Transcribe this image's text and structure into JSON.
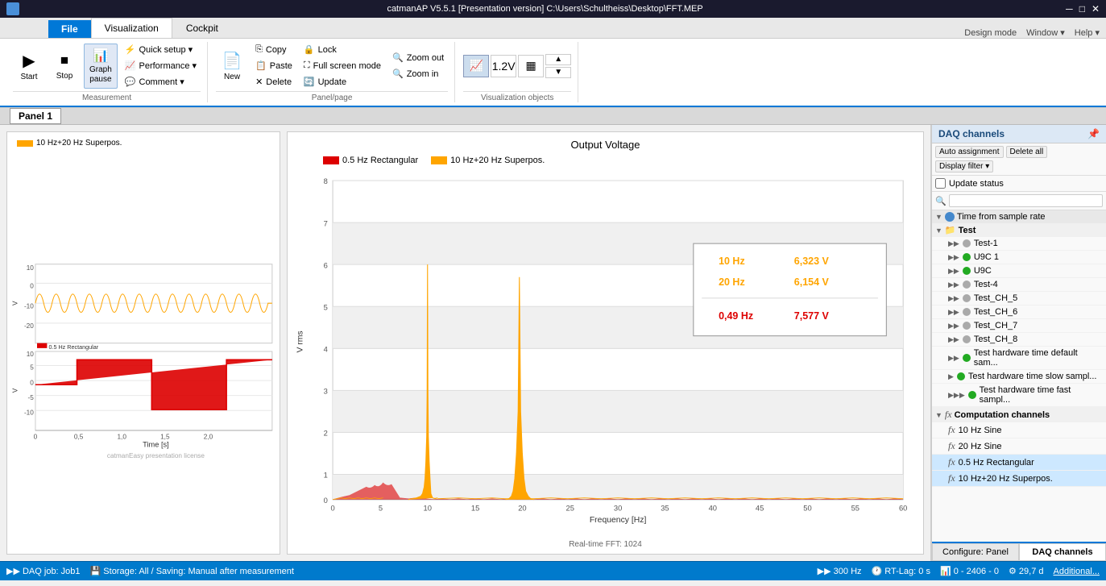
{
  "titlebar": {
    "title": "catmanAP V5.5.1 [Presentation version]  C:\\Users\\Schultheiss\\Desktop\\FFT.MEP",
    "logo": "app-logo",
    "minimize": "─",
    "restore": "□",
    "close": "✕"
  },
  "ribbon": {
    "tabs": [
      "File",
      "Visualization",
      "Cockpit"
    ],
    "active_tab": "Visualization",
    "right_links": [
      "Design mode",
      "Window ▾",
      "Help ▾"
    ],
    "groups": {
      "measurement": {
        "label": "Measurement",
        "start_btn": "Start",
        "stop_btn": "Stop",
        "graphpause_btn": "Graph\npause",
        "quick_setup": "Quick setup ▾",
        "performance": "Performance ▾",
        "comment": "Comment ▾"
      },
      "panel_page": {
        "label": "Panel/page",
        "new_btn": "New",
        "copy": "Copy",
        "paste": "Paste",
        "delete": "Delete",
        "lock": "Lock",
        "fullscreen": "Full screen mode",
        "zoom_in": "Zoom in",
        "zoom_out": "Zoom out",
        "update": "Update"
      },
      "vis_objects": {
        "label": "Visualization objects"
      }
    }
  },
  "panel_label": "Panel 1",
  "left_chart": {
    "legends": [
      {
        "label": "10 Hz+20 Hz Superpos.",
        "color": "#FFA500"
      },
      {
        "label": "0.5 Hz Rectangular",
        "color": "#DD0000"
      }
    ],
    "y_axis_label": "V",
    "x_axis_label": "Time  [s]",
    "watermark": "catmanEasy presentation license"
  },
  "right_chart": {
    "title": "Output Voltage",
    "legends": [
      {
        "label": "0.5 Hz Rectangular",
        "color": "#DD0000"
      },
      {
        "label": "10 Hz+20 Hz Superpos.",
        "color": "#FFA500"
      }
    ],
    "y_axis_label": "V rms",
    "x_axis_label": "Frequency  [Hz]",
    "subtitle": "Real-time FFT: 1024",
    "annotation": {
      "line1_label": "10 Hz",
      "line1_value": "6,323 V",
      "line1_color": "#FFA500",
      "line2_label": "20 Hz",
      "line2_value": "6,154 V",
      "line2_color": "#FFA500",
      "line3_label": "0,49 Hz",
      "line3_value": "7,577 V",
      "line3_color": "#DD0000"
    }
  },
  "daq_panel": {
    "title": "DAQ channels",
    "auto_assignment": "Auto assignment",
    "delete_all": "Delete all",
    "display_filter": "Display filter ▾",
    "update_status": "Update status",
    "search_placeholder": "",
    "sections": [
      {
        "name": "Time from sample rate",
        "type": "header",
        "icon": "blue-circle",
        "indent": 0
      },
      {
        "name": "Test",
        "type": "group",
        "icon": "folder",
        "indent": 0
      },
      {
        "name": "Test-1",
        "type": "item",
        "icon": "gray",
        "indent": 1
      },
      {
        "name": "U9C 1",
        "type": "item",
        "icon": "green",
        "indent": 1
      },
      {
        "name": "U9C",
        "type": "item",
        "icon": "green",
        "indent": 1
      },
      {
        "name": "Test-4",
        "type": "item",
        "icon": "gray",
        "indent": 1
      },
      {
        "name": "Test_CH_5",
        "type": "item",
        "icon": "gray",
        "indent": 1
      },
      {
        "name": "Test_CH_6",
        "type": "item",
        "icon": "gray",
        "indent": 1
      },
      {
        "name": "Test_CH_7",
        "type": "item",
        "icon": "gray",
        "indent": 1
      },
      {
        "name": "Test_CH_8",
        "type": "item",
        "icon": "gray",
        "indent": 1
      },
      {
        "name": "Test hardware time default sample",
        "type": "item",
        "icon": "green",
        "indent": 1
      },
      {
        "name": "Test hardware time slow sample",
        "type": "item",
        "icon": "green",
        "indent": 1
      },
      {
        "name": "Test hardware time fast sample",
        "type": "item",
        "icon": "green",
        "indent": 1
      },
      {
        "name": "Computation channels",
        "type": "group",
        "icon": "fx",
        "indent": 0
      },
      {
        "name": "10 Hz Sine",
        "type": "fx-item",
        "icon": "fx",
        "indent": 1
      },
      {
        "name": "20 Hz Sine",
        "type": "fx-item",
        "icon": "fx",
        "indent": 1
      },
      {
        "name": "0.5 Hz Rectangular",
        "type": "fx-item",
        "icon": "fx",
        "indent": 1,
        "highlighted": true
      },
      {
        "name": "10 Hz+20 Hz Superpos.",
        "type": "fx-item",
        "icon": "fx",
        "indent": 1,
        "highlighted": true
      }
    ],
    "bottom_tabs": [
      "Configure: Panel",
      "DAQ channels"
    ],
    "active_bottom_tab": "DAQ channels"
  },
  "statusbar": {
    "daq_job": "DAQ job: Job1",
    "storage": "Storage: All / Saving: Manual after measurement",
    "freq": "300 Hz",
    "rt_lag": "RT-Lag: 0 s",
    "samples": "0 - 2406 - 0",
    "disk": "29,7 d",
    "additional": "Additional..."
  }
}
